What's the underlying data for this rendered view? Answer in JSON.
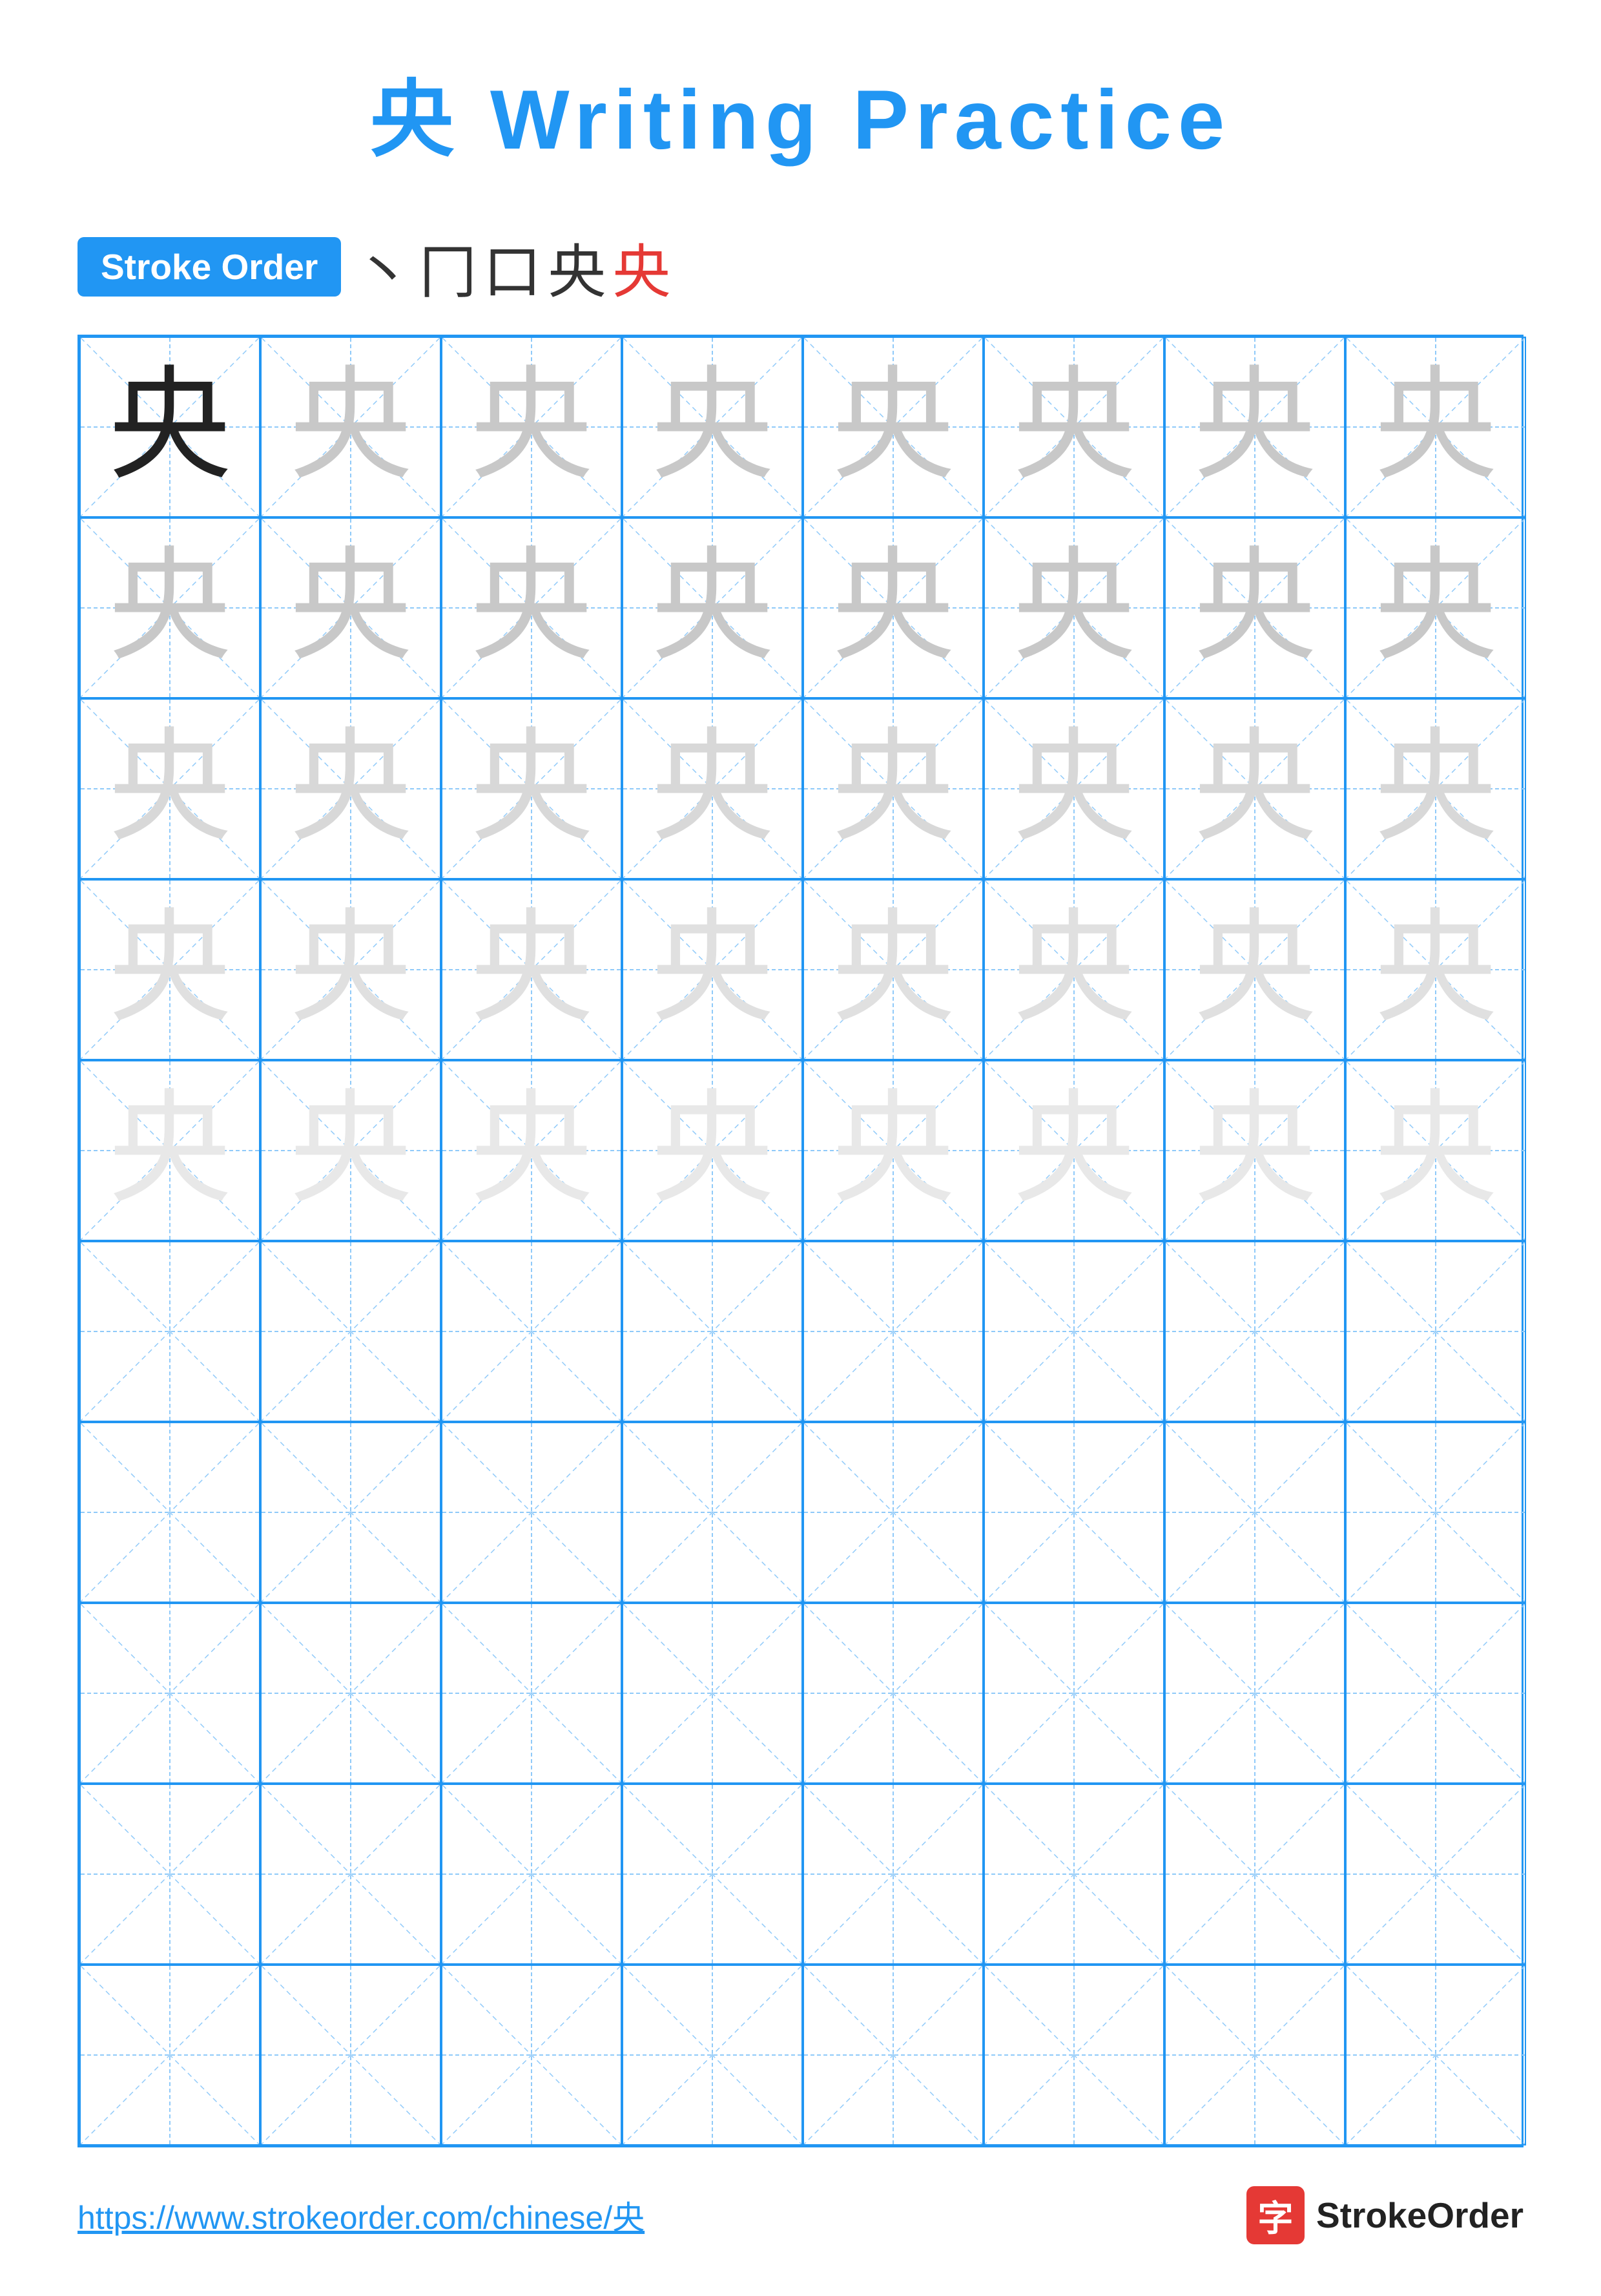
{
  "title": "央 Writing Practice",
  "stroke_order": {
    "badge_label": "Stroke Order",
    "strokes": [
      "丶",
      "冂",
      "口",
      "央",
      "央"
    ],
    "stroke_colors": [
      "black",
      "black",
      "black",
      "black",
      "red"
    ]
  },
  "character": "央",
  "grid": {
    "cols": 8,
    "rows": 10,
    "filled_rows": 5,
    "char_opacities": [
      "dark",
      "light1",
      "light2",
      "light3",
      "light4"
    ]
  },
  "footer": {
    "url": "https://www.strokeorder.com/chinese/央",
    "logo_char": "字",
    "logo_text": "StrokeOrder"
  }
}
